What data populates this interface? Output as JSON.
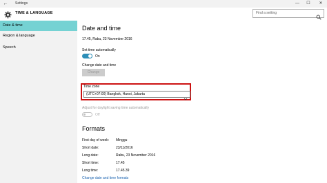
{
  "titlebar": {
    "back_glyph": "←",
    "title": "Settings",
    "minimize_glyph": "—",
    "maximize_glyph": "☐",
    "close_glyph": "✕"
  },
  "header": {
    "icon": "gear-icon",
    "title": "TIME & LANGUAGE"
  },
  "search": {
    "placeholder": "Find a setting",
    "icon": "search-icon"
  },
  "sidebar": {
    "items": [
      {
        "label": "Date & time",
        "active": true
      },
      {
        "label": "Region & language",
        "active": false
      },
      {
        "label": "Speech",
        "active": false
      }
    ]
  },
  "date_time": {
    "heading": "Date and time",
    "current": "17.45, Rabu, 23 November 2016",
    "auto_label": "Set time automatically",
    "auto_state": "On",
    "change_label": "Change date and time",
    "change_button": "Change",
    "tz_label": "Time zone",
    "tz_value": "(UTC+07:00) Bangkok, Hanoi, Jakarta",
    "dst_label": "Adjust for daylight saving time automatically",
    "dst_state": "Off"
  },
  "formats": {
    "heading": "Formats",
    "rows": [
      {
        "label": "First day of week:",
        "value": "Minggu"
      },
      {
        "label": "Short date:",
        "value": "23/11/2016"
      },
      {
        "label": "Long date:",
        "value": "Rabu, 23 November 2016"
      },
      {
        "label": "Short time:",
        "value": "17.45"
      },
      {
        "label": "Long time:",
        "value": "17.45.39"
      }
    ],
    "link": "Change date and time formats"
  },
  "colors": {
    "accent": "#2d8fb8",
    "sidebar_active": "#75d2d3",
    "highlight": "#cc1111",
    "link": "#1a63b0"
  }
}
